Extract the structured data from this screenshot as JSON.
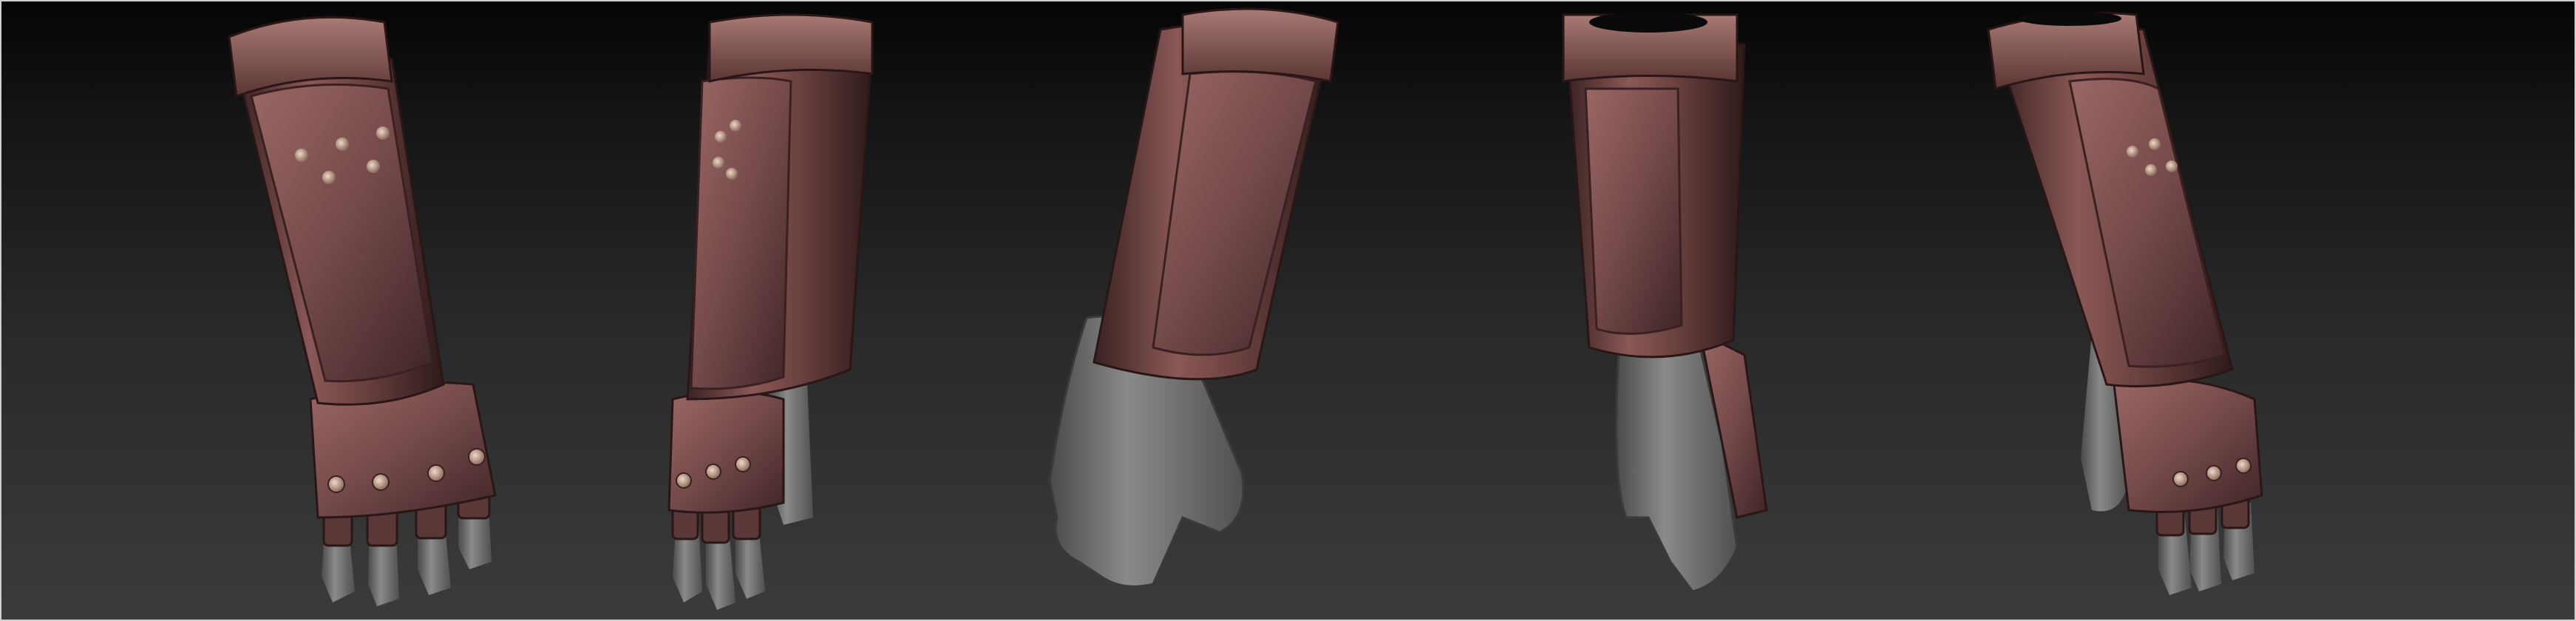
{
  "scene": {
    "view_count": 5,
    "views": [
      {
        "name": "front-view"
      },
      {
        "name": "front-three-quarter-view"
      },
      {
        "name": "side-view"
      },
      {
        "name": "back-view"
      },
      {
        "name": "rear-three-quarter-view"
      }
    ],
    "colors": {
      "background_top": "#050505",
      "background_bottom": "#3b3b3b",
      "leather": "#6b4240",
      "leather_highlight": "#a0706a",
      "leather_shadow": "#3a2222",
      "skin_clay": "#6e6e6e",
      "skin_highlight": "#9a9a9a",
      "rivet": "#c9a894"
    }
  }
}
